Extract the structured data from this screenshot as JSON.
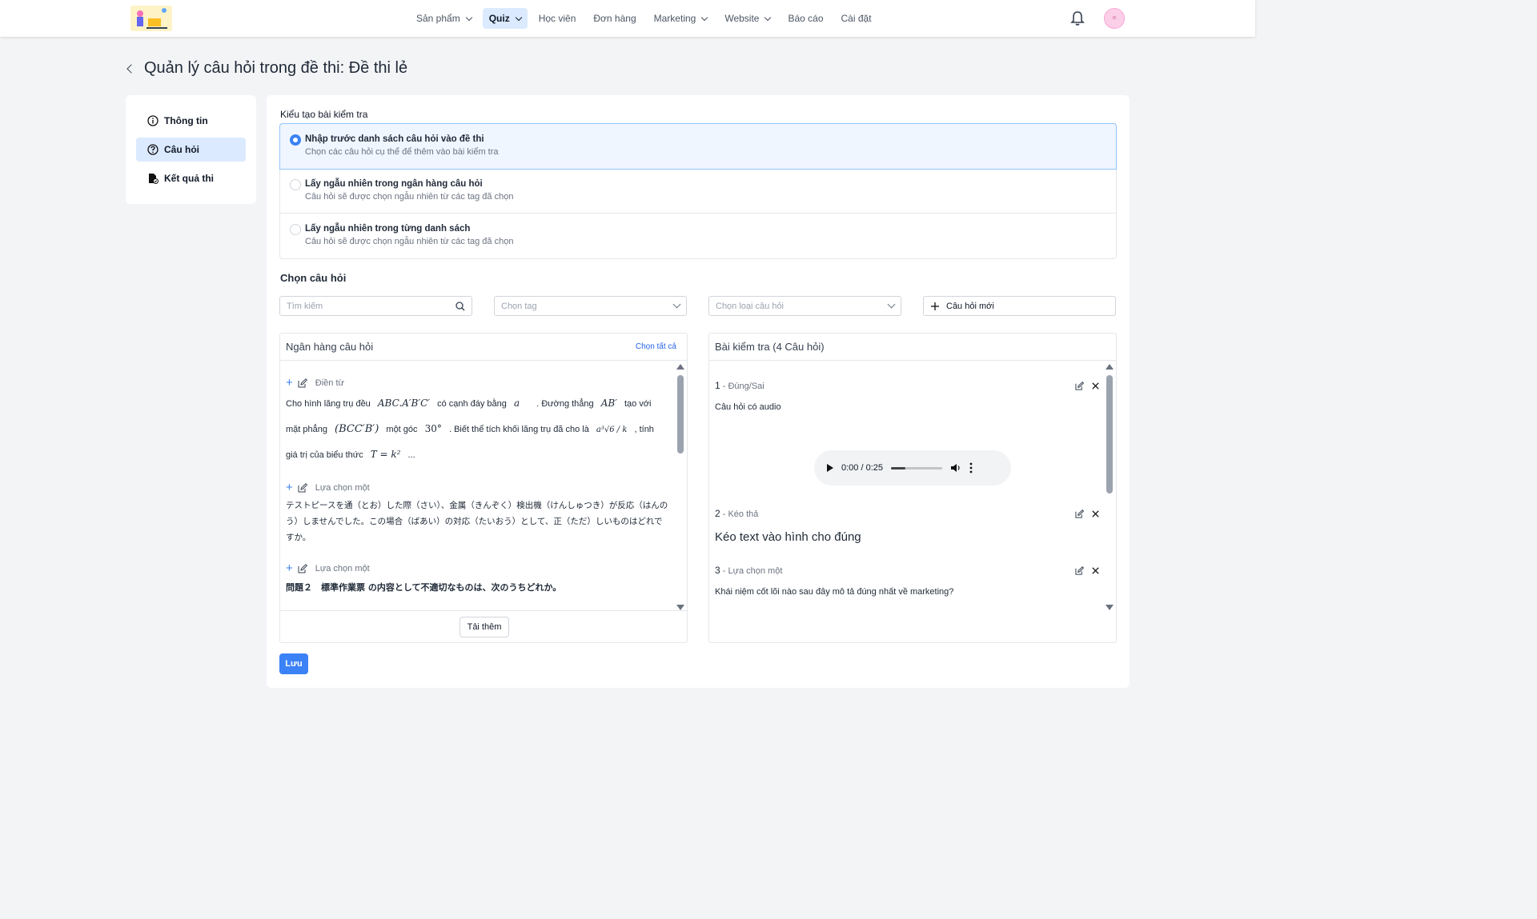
{
  "nav": {
    "items": [
      {
        "label": "Sản phẩm",
        "dropdown": true,
        "active": false
      },
      {
        "label": "Quiz",
        "dropdown": true,
        "active": true
      },
      {
        "label": "Học viên",
        "dropdown": false,
        "active": false
      },
      {
        "label": "Đơn hàng",
        "dropdown": false,
        "active": false
      },
      {
        "label": "Marketing",
        "dropdown": true,
        "active": false
      },
      {
        "label": "Website",
        "dropdown": true,
        "active": false
      },
      {
        "label": "Báo cáo",
        "dropdown": false,
        "active": false
      },
      {
        "label": "Cài đặt",
        "dropdown": false,
        "active": false
      }
    ]
  },
  "page": {
    "title": "Quản lý câu hỏi trong đề thi: Đề thi lẻ"
  },
  "sidebar": {
    "items": [
      {
        "label": "Thông tin",
        "icon": "info-icon",
        "active": false
      },
      {
        "label": "Câu hỏi",
        "icon": "question-icon",
        "active": true
      },
      {
        "label": "Kết quả thi",
        "icon": "result-file-icon",
        "active": false
      }
    ]
  },
  "test_type": {
    "label": "Kiểu tạo bài kiểm tra",
    "options": [
      {
        "title": "Nhập trước danh sách câu hỏi vào đề thi",
        "desc": "Chọn các câu hỏi cụ thể để thêm vào bài kiểm tra",
        "selected": true
      },
      {
        "title": "Lấy ngẫu nhiên trong ngân hàng câu hỏi",
        "desc": "Câu hỏi sẽ được chọn ngẫu nhiên từ các tag đã chọn",
        "selected": false
      },
      {
        "title": "Lấy ngẫu nhiên trong từng danh sách",
        "desc": "Câu hỏi sẽ được chọn ngẫu nhiên từ các tag đã chọn",
        "selected": false
      }
    ]
  },
  "choose": {
    "title": "Chọn câu hỏi",
    "search_placeholder": "Tìm kiếm",
    "tag_placeholder": "Chọn tag",
    "type_placeholder": "Chọn loại câu hỏi",
    "new_button": "Câu hỏi mới"
  },
  "bank": {
    "title": "Ngân hàng câu hỏi",
    "select_all": "Chọn tất cả",
    "load_more": "Tải thêm",
    "questions": [
      {
        "type": "Điền từ",
        "line1": [
          "Cho hình lăng trụ đều",
          "ABC.A′B′C′",
          "có cạnh đáy bằng",
          "a",
          ". Đường thẳng",
          "AB′",
          "tạo với"
        ],
        "line2": [
          "mặt phẳng",
          "(BCC′B′)",
          "một góc",
          "30°",
          ". Biết thể tích khối lăng trụ đã cho là",
          "a³√6 / k",
          ", tính"
        ],
        "line3": [
          "giá trị của biểu thức",
          "T = k²",
          "..."
        ]
      },
      {
        "type": "Lựa chọn một",
        "text": "テストピースを通（とお）した際（さい）、金属（きんぞく）検出機（けんしゅつき）が反応（はんのう）しませんでした。この場合（ばあい）の対応（たいおう）として、正（ただ）しいものはどれですか。"
      },
      {
        "type": "Lựa chọn một",
        "text": "問題２　標準作業票 の内容として不適切なものは、次のうちどれか。"
      }
    ]
  },
  "test": {
    "title": "Bài kiểm tra (4 Câu hỏi)",
    "questions": [
      {
        "num": "1",
        "type": "Đúng/Sai",
        "text": "Câu hỏi có audio",
        "audio_time": "0:00 / 0:25"
      },
      {
        "num": "2",
        "type": "Kéo thả",
        "text": "Kéo text vào hình cho đúng"
      },
      {
        "num": "3",
        "type": "Lựa chọn một",
        "text": "Khái niệm cốt lõi nào sau đây mô tả đúng nhất về marketing?"
      }
    ]
  },
  "actions": {
    "save": "Lưu"
  },
  "colors": {
    "primary": "#3b82f6",
    "active_bg": "#dbeafe",
    "link": "#2563eb"
  }
}
